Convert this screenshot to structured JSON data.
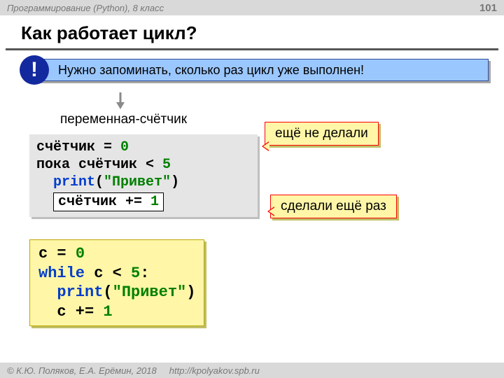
{
  "header": {
    "course": "Программирование (Python), 8 класс",
    "page": "101"
  },
  "title": "Как работает цикл?",
  "tip": {
    "mark": "!",
    "text": "Нужно запоминать, сколько раз цикл уже выполнен!"
  },
  "labels": {
    "counter_var": "переменная-счётчик"
  },
  "code1": {
    "l1a": "счётчик = ",
    "l1b": "0",
    "l2a": "пока счётчик < ",
    "l2b": "5",
    "l3a": "print",
    "l3b": "(",
    "l3c": "\"Привет\"",
    "l3d": ")",
    "l4a": "счётчик += ",
    "l4b": "1"
  },
  "code2": {
    "l1a": "c = ",
    "l1b": "0",
    "l2a": "while",
    "l2b": " c < ",
    "l2c": "5",
    "l2d": ":",
    "l3a": "print",
    "l3b": "(",
    "l3c": "\"Привет\"",
    "l3d": ")",
    "l4a": "c += ",
    "l4b": "1"
  },
  "hints": {
    "not_yet": "ещё не делали",
    "did_again": "сделали ещё раз"
  },
  "footer": {
    "copyright": "© К.Ю. Поляков, Е.А. Ерёмин, 2018",
    "url": "http://kpolyakov.spb.ru"
  }
}
